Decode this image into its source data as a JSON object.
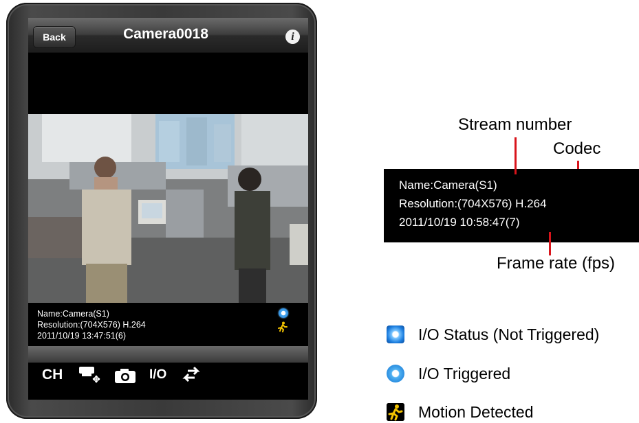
{
  "app": {
    "back_label": "Back",
    "title": "Camera0018",
    "info_icon": "info-icon"
  },
  "overlay": {
    "name": "Name:Camera(S1)",
    "resolution": "Resolution:(704X576) H.264",
    "timestamp": "2011/10/19 13:47:51(6)"
  },
  "toolbar": {
    "ch_label": "CH",
    "ptz_icon": "ptz-icon",
    "snapshot_icon": "camera-icon",
    "io_label": "I/O",
    "transfer_icon": "transfer-arrows-icon"
  },
  "annotation": {
    "stream_number": "Stream number",
    "codec": "Codec",
    "frame_rate": "Frame rate (fps)",
    "zoom_name": "Name:Camera(S1)",
    "zoom_resolution": "Resolution:(704X576) H.264",
    "zoom_timestamp": "2011/10/19 10:58:47(7)"
  },
  "legend": [
    {
      "icon": "io-status-not-triggered-icon",
      "label": "I/O Status (Not Triggered)"
    },
    {
      "icon": "io-triggered-icon",
      "label": "I/O Triggered"
    },
    {
      "icon": "motion-detected-icon",
      "label": "Motion Detected"
    }
  ],
  "colors": {
    "accent_red": "#d8141b",
    "io_blue": "#1d7fe0",
    "motion_yellow": "#f2c200"
  }
}
